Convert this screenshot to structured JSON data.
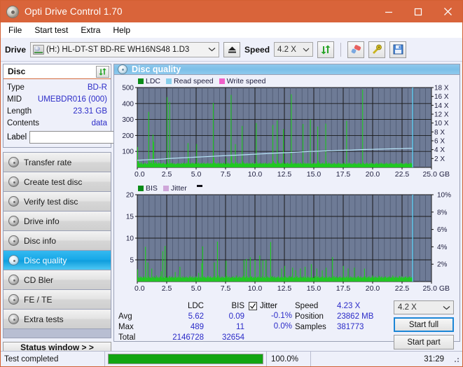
{
  "window": {
    "title": "Opti Drive Control 1.70",
    "icon": "disc-icon",
    "minimize": "minimize-icon",
    "maximize": "maximize-icon",
    "close": "close-icon"
  },
  "menu": {
    "items": [
      "File",
      "Start test",
      "Extra",
      "Help"
    ]
  },
  "drivebar": {
    "drive_label": "Drive",
    "drive_value": "(H:)  HL-DT-ST BD-RE  WH16NS48 1.D3",
    "eject": "eject-icon",
    "speed_label": "Speed",
    "speed_value": "4.2 X",
    "refresh": "refresh-icon",
    "erase": "erase-icon",
    "tools": "tools-icon",
    "save": "save-icon"
  },
  "disc_panel": {
    "title": "Disc",
    "refresh": "refresh-icon",
    "rows": [
      {
        "key": "Type",
        "value": "BD-R"
      },
      {
        "key": "MID",
        "value": "UMEBDR016 (000)"
      },
      {
        "key": "Length",
        "value": "23.31 GB"
      },
      {
        "key": "Contents",
        "value": "data"
      }
    ],
    "label_key": "Label",
    "label_value": "",
    "label_placeholder": ""
  },
  "nav": {
    "items": [
      {
        "label": "Transfer rate",
        "active": false
      },
      {
        "label": "Create test disc",
        "active": false
      },
      {
        "label": "Verify test disc",
        "active": false
      },
      {
        "label": "Drive info",
        "active": false
      },
      {
        "label": "Disc info",
        "active": false
      },
      {
        "label": "Disc quality",
        "active": true
      },
      {
        "label": "CD Bler",
        "active": false
      },
      {
        "label": "FE / TE",
        "active": false
      },
      {
        "label": "Extra tests",
        "active": false
      }
    ],
    "status_window": "Status window > >"
  },
  "content": {
    "header": "Disc quality",
    "header_icon": "disc-quality-icon"
  },
  "chart_data": [
    {
      "type": "bar",
      "name": "ldc-chart",
      "title": "",
      "xlabel": "GB",
      "ylabel": "",
      "xlim": [
        0,
        25
      ],
      "xticks": [
        "0.0",
        "2.5",
        "5.0",
        "7.5",
        "10.0",
        "12.5",
        "15.0",
        "17.5",
        "20.0",
        "22.5",
        "25.0 GB"
      ],
      "ylim": [
        0,
        500
      ],
      "yticks": [
        "100",
        "200",
        "300",
        "400",
        "500"
      ],
      "y2lim": [
        0,
        18
      ],
      "y2ticks": [
        "2 X",
        "4 X",
        "6 X",
        "8 X",
        "10 X",
        "12 X",
        "14 X",
        "16 X",
        "18 X"
      ],
      "grid": true,
      "legend": [
        {
          "label": "LDC",
          "color": "#0a8c18"
        },
        {
          "label": "Read speed",
          "color": "#87ceeb"
        },
        {
          "label": "Write speed",
          "color": "#f060c8"
        }
      ],
      "plot_bg": "#6e7b96",
      "data_end_x": 23.4,
      "series": [
        {
          "name": "LDC",
          "color": "#1ecb1e",
          "x_max": 23.4,
          "values": [
            128,
            44,
            30,
            22,
            28,
            20,
            34,
            24,
            18,
            22,
            26,
            20,
            30,
            24,
            22,
            18,
            26,
            20,
            348,
            40,
            30,
            26,
            44,
            30,
            22,
            206,
            160,
            26,
            30,
            22,
            38,
            26,
            24,
            20,
            30,
            26,
            22,
            28,
            24,
            20,
            26,
            22,
            30,
            24,
            20,
            18,
            24,
            20,
            440,
            30,
            24,
            22,
            410,
            28,
            22,
            26,
            30,
            22,
            20,
            26,
            24,
            18,
            20,
            24,
            22,
            28,
            20,
            26,
            24,
            22,
            20,
            28,
            24,
            22,
            26,
            30,
            24,
            20,
            26,
            22,
            30,
            24,
            152,
            62,
            26,
            20,
            24,
            28,
            22,
            30,
            24,
            26,
            20,
            24,
            30,
            22,
            146,
            26,
            22,
            30,
            24,
            20,
            26,
            22,
            28,
            24,
            20,
            26,
            30,
            22,
            24,
            20,
            26,
            22,
            30,
            24,
            20,
            26,
            22,
            28,
            24,
            20,
            26,
            404,
            60,
            26,
            30,
            24,
            20,
            26,
            22,
            30,
            24,
            20,
            26,
            22,
            28,
            24,
            20,
            26,
            30,
            22,
            24,
            20,
            58,
            26,
            22,
            30,
            24,
            20,
            26,
            22,
            454,
            78,
            26,
            30,
            24,
            20,
            26,
            146,
            34,
            22,
            30,
            24,
            20,
            26,
            22,
            28,
            24,
            20,
            260,
            38,
            26,
            30,
            24,
            20,
            26,
            22,
            30,
            24,
            20,
            26,
            22,
            28,
            24,
            20,
            26,
            30,
            22,
            24,
            20,
            26,
            22,
            278,
            34,
            24,
            20,
            26,
            22,
            30,
            24,
            20,
            26,
            22,
            28,
            24,
            20,
            26,
            30,
            22,
            24,
            20,
            26,
            22,
            30,
            24,
            20,
            26,
            22,
            28,
            266,
            40,
            26,
            30,
            22,
            24,
            20,
            294,
            44,
            26,
            30,
            24,
            20,
            26,
            22,
            30,
            24,
            240,
            26,
            22,
            28,
            24,
            20,
            26,
            30,
            22,
            24,
            20,
            26,
            22,
            458,
            36,
            24,
            20,
            26,
            22,
            30,
            24,
            20,
            26,
            22,
            28,
            24,
            20,
            26,
            30,
            22,
            24,
            20,
            272,
            26,
            22,
            30,
            24,
            20,
            26,
            22,
            28,
            24,
            20,
            26,
            300,
            22,
            24,
            20,
            26,
            22,
            30,
            24,
            20,
            26,
            22,
            28,
            256,
            40,
            26,
            30,
            24,
            20,
            26,
            22,
            30,
            24,
            20,
            26,
            22,
            274,
            38,
            26,
            20,
            24,
            30,
            22,
            26,
            20,
            24,
            18,
            22,
            26,
            20,
            30,
            24,
            22,
            18,
            26,
            20,
            24,
            30,
            22,
            26,
            20,
            24,
            18,
            22,
            26,
            20,
            30,
            24,
            22,
            18,
            292,
            26,
            20,
            24,
            30,
            22,
            26,
            20,
            24,
            18,
            22,
            26,
            20,
            30,
            24,
            22,
            18,
            26,
            20,
            24,
            30,
            22,
            26,
            20,
            24,
            18,
            488,
            30,
            24,
            22,
            18,
            26,
            20,
            30,
            24,
            22,
            18,
            26,
            20,
            24,
            30,
            22,
            26,
            20,
            24,
            18,
            22,
            26,
            20,
            30,
            24,
            22,
            18,
            26,
            20,
            24,
            30,
            22,
            26,
            20,
            24,
            18,
            22,
            26,
            20,
            30,
            24,
            22,
            18,
            26,
            20,
            24,
            30,
            22,
            26,
            20,
            24,
            18,
            22,
            26,
            20,
            30,
            24,
            22,
            18,
            26,
            20,
            24,
            30,
            22,
            26,
            20,
            24,
            18,
            22,
            26,
            20,
            30,
            24,
            22,
            18,
            26,
            20,
            24,
            30,
            22,
            26,
            20
          ]
        },
        {
          "name": "Read speed",
          "color": "#b7e4f7",
          "axis": "right",
          "x_max": 23.4,
          "values": [
            1.6,
            1.65,
            1.7,
            1.75,
            1.8,
            1.85,
            1.9,
            2.0,
            2.05,
            2.1,
            2.15,
            2.2,
            2.25,
            2.3,
            2.35,
            2.4,
            2.45,
            2.5,
            2.55,
            2.6,
            2.65,
            2.7,
            2.75,
            2.8,
            2.85,
            2.9,
            2.95,
            3.0,
            3.05,
            3.1,
            3.15,
            3.2,
            3.25,
            3.3,
            3.35,
            3.4,
            3.45,
            3.5,
            3.55,
            3.6,
            3.62,
            3.65,
            3.7,
            3.72,
            3.75,
            3.8,
            3.85,
            3.88,
            3.9,
            3.95,
            4.0,
            4.02,
            4.05,
            4.08,
            4.1,
            4.12,
            4.15,
            4.18,
            4.2,
            4.22,
            4.25,
            4.28,
            4.3
          ]
        },
        {
          "name": "Write speed",
          "color": "#f060c8",
          "axis": "right",
          "values": []
        }
      ]
    },
    {
      "type": "bar",
      "name": "bis-jitter-chart",
      "title": "",
      "xlabel": "GB",
      "ylabel": "",
      "xlim": [
        0,
        25
      ],
      "xticks": [
        "0.0",
        "2.5",
        "5.0",
        "7.5",
        "10.0",
        "12.5",
        "15.0",
        "17.5",
        "20.0",
        "22.5",
        "25.0 GB"
      ],
      "ylim": [
        0,
        20
      ],
      "yticks": [
        "5",
        "10",
        "15",
        "20"
      ],
      "y2lim": [
        0,
        10
      ],
      "y2ticks": [
        "2%",
        "4%",
        "6%",
        "8%",
        "10%"
      ],
      "grid": true,
      "legend": [
        {
          "label": "BIS",
          "color": "#0a8c18"
        },
        {
          "label": "Jitter",
          "color": "#cfa6d9"
        }
      ],
      "plot_bg": "#6e7b96",
      "data_end_x": 23.4,
      "series": [
        {
          "name": "BIS",
          "color": "#1ecb1e",
          "x_max": 23.4,
          "values": [
            2.8,
            1.0,
            0.8,
            1.2,
            0.9,
            1.1,
            0.8,
            1.0,
            1.2,
            0.9,
            8.0,
            1.0,
            0.8,
            4.4,
            1.2,
            0.9,
            1.0,
            0.8,
            3.0,
            1.1,
            0.9,
            1.2,
            0.8,
            1.0,
            1.4,
            0.9,
            1.1,
            0.8,
            1.0,
            1.2,
            2.4,
            0.9,
            7.0,
            1.0,
            0.8,
            8.2,
            1.2,
            0.9,
            1.0,
            0.8,
            1.1,
            1.3,
            0.9,
            1.0,
            1.2,
            0.8,
            1.0,
            0.9,
            2.2,
            1.1,
            0.8,
            1.0,
            1.2,
            0.9,
            3.4,
            1.0,
            0.8,
            1.2,
            0.9,
            1.1,
            0.8,
            1.0,
            1.2,
            0.9,
            1.0,
            0.8,
            1.1,
            1.3,
            0.9,
            1.0,
            1.2,
            0.8,
            1.0,
            0.9,
            1.1,
            1.2,
            0.8,
            1.0,
            2.0,
            0.9,
            1.1,
            0.8,
            4.2,
            8.1,
            1.0,
            1.2,
            0.9,
            1.0,
            0.8,
            1.1,
            1.3,
            0.9,
            1.0,
            1.2,
            0.8,
            1.0,
            0.9,
            1.1,
            4.4,
            1.2,
            0.8,
            1.0,
            9.2,
            1.4,
            0.9,
            1.1,
            0.8,
            1.0,
            1.2,
            0.9,
            1.0,
            0.8,
            1.1,
            4.8,
            1.3,
            0.9,
            1.0,
            1.2,
            0.8,
            1.0,
            0.9,
            1.1,
            1.2,
            0.8,
            1.0,
            0.9,
            1.4,
            1.1,
            0.8,
            1.0,
            1.2,
            0.9,
            1.0,
            0.8,
            1.1,
            1.3,
            5.0,
            0.9,
            1.0,
            5.2,
            1.2,
            0.8,
            1.0,
            0.9,
            5.6,
            1.1,
            1.2,
            0.8,
            1.0,
            0.9,
            5.0,
            1.1,
            0.8,
            1.0,
            1.2,
            0.9,
            6.0,
            1.0,
            0.8,
            1.2,
            4.9,
            0.9,
            1.1,
            0.8,
            5.0,
            1.0,
            1.2,
            0.9,
            1.0,
            0.8,
            9.1,
            1.1,
            1.3,
            0.9,
            1.0,
            1.2,
            0.8,
            1.0,
            0.9,
            1.1,
            1.2,
            0.8,
            1.0,
            0.9,
            3.0,
            1.1,
            0.8,
            1.0,
            3.6,
            1.2,
            0.9,
            1.0,
            0.8,
            1.1,
            1.3,
            0.9,
            1.0,
            1.2,
            3.2,
            0.8,
            1.0,
            0.9,
            2.6,
            1.1,
            1.2,
            0.8,
            1.0,
            0.9,
            3.0,
            1.1,
            0.8,
            1.0,
            1.2,
            0.9,
            3.4,
            1.0,
            0.8,
            1.2,
            0.9,
            1.1,
            0.8,
            1.0,
            4.0,
            0.9,
            1.0,
            0.8,
            1.1,
            1.3,
            0.9,
            3.0,
            1.0,
            1.2,
            0.8,
            1.0,
            0.9,
            1.1,
            2.6,
            1.2,
            0.8,
            1.0,
            0.9,
            3.2,
            1.1,
            0.8,
            1.0,
            1.2,
            0.9,
            1.0,
            0.8,
            5.6,
            1.1,
            1.3,
            0.9,
            1.0,
            1.2,
            0.8,
            1.0,
            0.9,
            1.1,
            1.2,
            0.8,
            1.0,
            0.9,
            3.6,
            1.1,
            0.8,
            1.0,
            1.2,
            0.9,
            3.0,
            1.0,
            0.8,
            1.2,
            0.9,
            1.1,
            0.8,
            1.0,
            3.2,
            0.9,
            1.0,
            0.8,
            1.1,
            1.3,
            0.9,
            1.0,
            1.2,
            0.8,
            1.0,
            0.9,
            1.1,
            3.0,
            1.2,
            0.8,
            1.0,
            0.9,
            1.1,
            1.2,
            0.8,
            1.0,
            0.9,
            1.4,
            1.1,
            0.8,
            1.0,
            1.2,
            0.9,
            1.0,
            0.8,
            1.1,
            1.3,
            0.9,
            1.0,
            1.2,
            0.8,
            1.0,
            0.9,
            1.1,
            1.2,
            0.8,
            1.0,
            0.9,
            1.1,
            1.2,
            0.8,
            1.0,
            0.9,
            1.4,
            1.1,
            0.8,
            1.0,
            1.2,
            0.9,
            1.0,
            0.8,
            1.1,
            1.3,
            0.9,
            1.0,
            1.2,
            0.8,
            1.0,
            0.9,
            1.1,
            1.2,
            0.8,
            1.0,
            0.9,
            1.1,
            1.2,
            0.8,
            1.0,
            0.9
          ]
        },
        {
          "name": "Jitter",
          "color": "#cfa6d9",
          "axis": "right",
          "values": []
        }
      ]
    }
  ],
  "stats": {
    "col_headers": [
      "",
      "LDC",
      "BIS"
    ],
    "rows": [
      {
        "label": "Avg",
        "ldc": "5.62",
        "bis": "0.09"
      },
      {
        "label": "Max",
        "ldc": "489",
        "bis": "11"
      },
      {
        "label": "Total",
        "ldc": "2146728",
        "bis": "32654"
      }
    ],
    "jitter": {
      "checked": true,
      "label": "Jitter",
      "values": [
        "-0.1%",
        "0.0%"
      ]
    },
    "right": [
      {
        "label": "Speed",
        "value": "4.23 X"
      },
      {
        "label": "Position",
        "value": "23862 MB"
      },
      {
        "label": "Samples",
        "value": "381773"
      }
    ],
    "speed_select": "4.2 X",
    "start_full": "Start full",
    "start_part": "Start part"
  },
  "statusbar": {
    "message": "Test completed",
    "progress_pct": 100,
    "progress_text": "100.0%",
    "elapsed": "31:29"
  }
}
